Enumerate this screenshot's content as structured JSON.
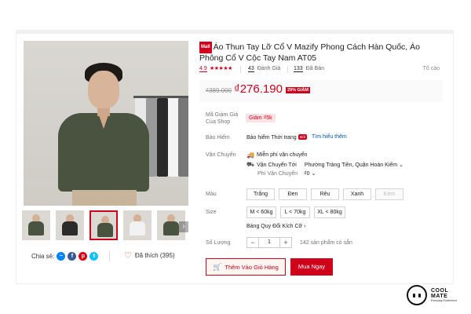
{
  "product": {
    "mall_badge": "Mall",
    "title": "Áo Thun Tay Lỡ Cổ V Mazify Phong Cách Hàn Quốc, Áo Phông Cổ V Cộc Tay Nam AT05",
    "rating": "4.9",
    "stars": "★★★★★",
    "review_count": "43",
    "review_label": "Đánh Giá",
    "sold_count": "133",
    "sold_label": "Đã Bán",
    "report": "Tố cáo"
  },
  "price": {
    "original": "₫389.000",
    "current": "₫276.190",
    "discount": "29% GIẢM"
  },
  "voucher": {
    "label": "Mã Giảm Giá Của Shop",
    "tag": "Giảm ₫5k"
  },
  "insurance": {
    "label": "Bảo Hiểm",
    "name": "Bảo hiểm Thời trang",
    "new_badge": "Mới",
    "more": "Tìm hiểu thêm"
  },
  "shipping": {
    "label": "Vận Chuyển",
    "free": "Miễn phí vận chuyển",
    "to_label": "Vận Chuyển Tới",
    "destination": "Phường Tràng Tiền, Quận Hoàn Kiếm",
    "fee_label": "Phí Vận Chuyển",
    "fee": "₫0"
  },
  "color": {
    "label": "Màu",
    "options": [
      "Trắng",
      "Đen",
      "Rêu",
      "Xanh",
      "Kem"
    ]
  },
  "size": {
    "label": "Size",
    "options": [
      "M < 60kg",
      "L < 70kg",
      "XL < 80kg"
    ],
    "guide": "Bảng Quy Đổi Kích Cỡ"
  },
  "quantity": {
    "label": "Số Lượng",
    "minus": "−",
    "value": "1",
    "plus": "+",
    "stock": "142 sản phẩm có sẵn"
  },
  "actions": {
    "add_to_cart": "Thêm Vào Giỏ Hàng",
    "buy_now": "Mua Ngay"
  },
  "social": {
    "share_label": "Chia sẻ:",
    "liked": "Đã thích (395)"
  },
  "logo": {
    "line1": "COOL",
    "line2": "MATE",
    "tagline": "Everyday Excitement"
  },
  "colors": {
    "accent": "#d0011b",
    "shirt": "#4a5240"
  },
  "icons": [
    "messenger-icon",
    "facebook-icon",
    "pinterest-icon",
    "twitter-icon",
    "heart-icon",
    "truck-icon",
    "cart-icon",
    "chevron-right-icon",
    "chevron-down-icon"
  ]
}
